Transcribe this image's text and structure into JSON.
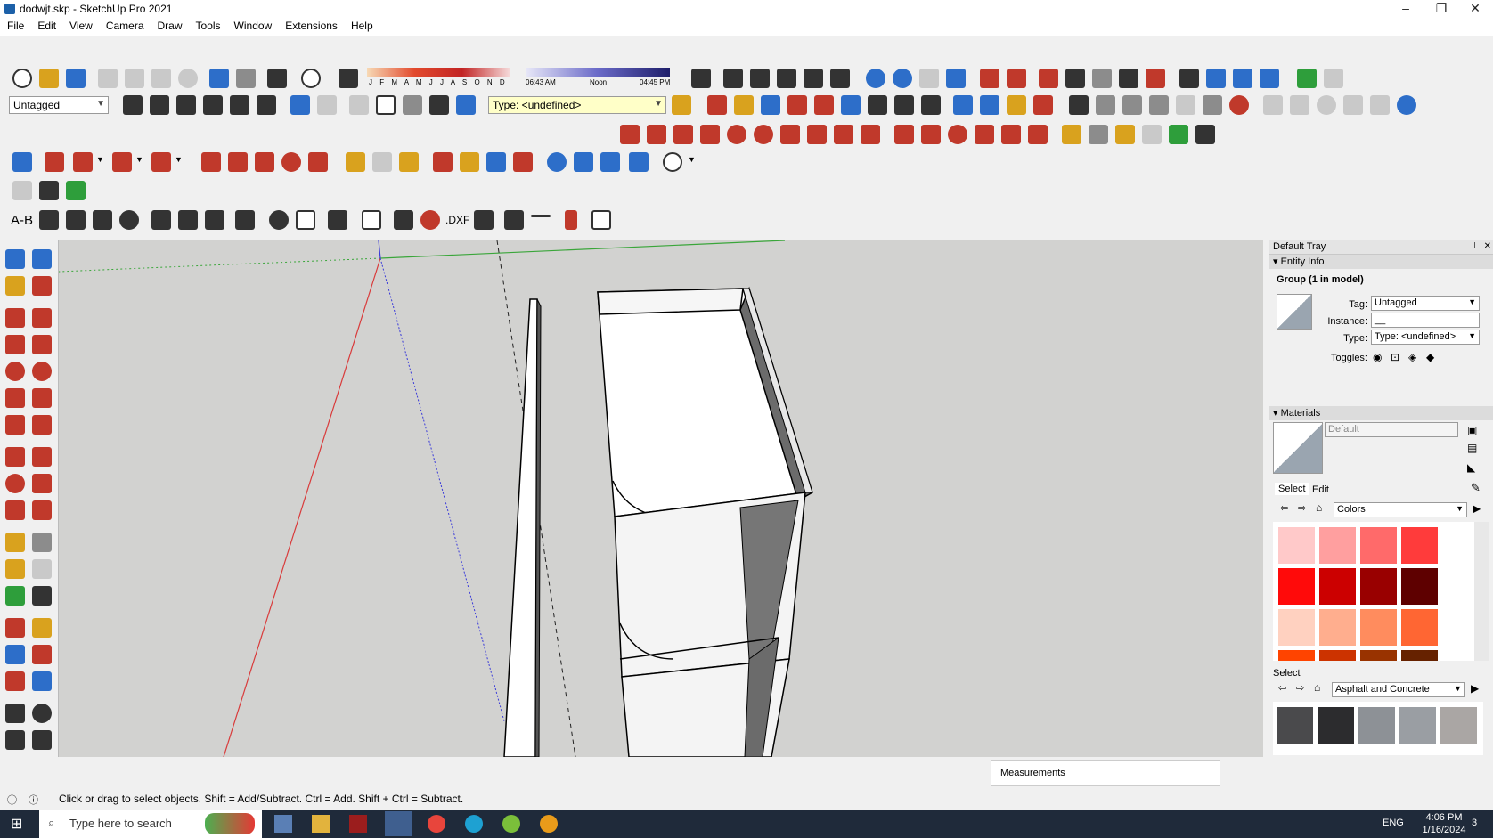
{
  "window": {
    "title": "dodwjt.skp - SketchUp Pro 2021",
    "minimize": "–",
    "restore": "❐",
    "close": "✕"
  },
  "menu": [
    "File",
    "Edit",
    "View",
    "Camera",
    "Draw",
    "Tools",
    "Window",
    "Extensions",
    "Help"
  ],
  "toolbar": {
    "tag_dropdown": "Untagged",
    "type_dropdown": "Type: <undefined>",
    "shadow_months": "J F M A M J J A S O N D",
    "shadow_time_start": "06:43 AM",
    "shadow_time_noon": "Noon",
    "shadow_time_end": "04:45 PM",
    "dim_label": "A-B",
    "dxf_label": ".DXF"
  },
  "tray": {
    "title": "Default Tray",
    "entity_info": {
      "header": "Entity Info",
      "group_title": "Group (1 in model)",
      "tag_label": "Tag:",
      "tag_value": "Untagged",
      "instance_label": "Instance:",
      "instance_value": "__",
      "type_label": "Type:",
      "type_value": "Type: <undefined>",
      "toggles_label": "Toggles:"
    },
    "materials": {
      "header": "Materials",
      "material_name": "Default",
      "tab_select": "Select",
      "tab_edit": "Edit",
      "collection": "Colors",
      "swatches": [
        "#ffc9c9",
        "#ff9f9f",
        "#ff6a6a",
        "#ff3b3b",
        "#ff0a0a",
        "#cc0000",
        "#990000",
        "#5e0000",
        "#ffd1c0",
        "#ffae8e",
        "#ff8c5e",
        "#ff6633",
        "#ff4400",
        "#cc3300",
        "#993300",
        "#662200"
      ],
      "secondary_select": "Select",
      "secondary_collection": "Asphalt and Concrete",
      "secondary_swatches": [
        "#4a4a4c",
        "#2c2c2e",
        "#8d9196",
        "#9a9ea3",
        "#aaa6a4"
      ]
    }
  },
  "status": {
    "hint": "Click or drag to select objects. Shift = Add/Subtract. Ctrl = Add. Shift + Ctrl = Subtract.",
    "measurements_label": "Measurements"
  },
  "taskbar": {
    "search_placeholder": "Type here to search",
    "language": "ENG",
    "time": "4:06 PM",
    "date": "1/16/2024",
    "notifications": "3"
  },
  "colors": {
    "axis_red": "#d93a3a",
    "axis_green": "#3aa63a",
    "axis_blue": "#3a3ad9",
    "viewport_bg": "#d2d2d0"
  }
}
